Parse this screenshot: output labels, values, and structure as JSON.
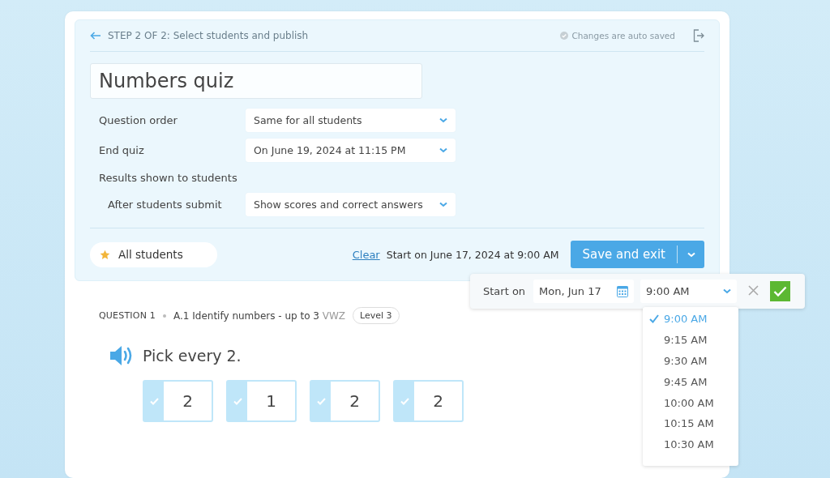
{
  "header": {
    "step": "STEP 2 OF 2: Select students and publish",
    "autosave": "Changes are auto saved"
  },
  "quiz_title": {
    "value": "Numbers quiz"
  },
  "settings": [
    {
      "kind": "select",
      "label": "Question order",
      "value": "Same for all students"
    },
    {
      "kind": "select",
      "label": "End quiz",
      "value": "On June 19, 2024 at 11:15 PM"
    },
    {
      "kind": "heading",
      "label": "Results shown to students"
    },
    {
      "kind": "select",
      "label": "After students submit",
      "value": "Show scores and correct answers"
    }
  ],
  "students": {
    "label": "All students"
  },
  "schedule": {
    "clear": "Clear",
    "summary": "Start on June 17, 2024 at 9:00 AM",
    "save_button": "Save and exit"
  },
  "start_popover": {
    "label": "Start on",
    "date": "Mon, Jun 17",
    "time": "9:00 AM",
    "time_options": [
      {
        "label": "9:00 AM",
        "selected": true
      },
      {
        "label": "9:15 AM",
        "selected": false
      },
      {
        "label": "9:30 AM",
        "selected": false
      },
      {
        "label": "9:45 AM",
        "selected": false
      },
      {
        "label": "10:00 AM",
        "selected": false
      },
      {
        "label": "10:15 AM",
        "selected": false
      },
      {
        "label": "10:30 AM",
        "selected": false
      }
    ]
  },
  "question": {
    "number": "QUESTION 1",
    "skill": "A.1 Identify numbers - up to 3",
    "code": "VWZ",
    "level": "Level 3",
    "prompt": "Pick every 2.",
    "choices": [
      {
        "label": "2"
      },
      {
        "label": "1"
      },
      {
        "label": "2"
      },
      {
        "label": "2"
      }
    ]
  }
}
